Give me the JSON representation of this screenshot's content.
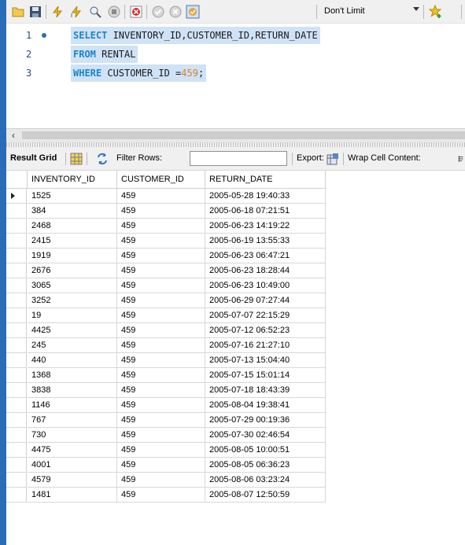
{
  "toolbar": {
    "limit_label": "Don't Limit"
  },
  "editor": {
    "lines": [
      {
        "number": "1",
        "keyword1": "SELECT",
        "rest": " INVENTORY_ID,CUSTOMER_ID,RETURN_DATE"
      },
      {
        "number": "2",
        "keyword1": "FROM",
        "rest": " RENTAL"
      },
      {
        "number": "3",
        "keyword1": "WHERE",
        "rest": " CUSTOMER_ID =",
        "number_literal": "459",
        "tail": ";"
      }
    ]
  },
  "result_toolbar": {
    "result_grid_label": "Result Grid",
    "filter_rows_label": "Filter Rows:",
    "filter_value": "",
    "export_label": "Export:",
    "wrap_label": "Wrap Cell Content:"
  },
  "grid": {
    "columns": [
      "INVENTORY_ID",
      "CUSTOMER_ID",
      "RETURN_DATE"
    ],
    "rows": [
      [
        "1525",
        "459",
        "2005-05-28 19:40:33"
      ],
      [
        "384",
        "459",
        "2005-06-18 07:21:51"
      ],
      [
        "2468",
        "459",
        "2005-06-23 14:19:22"
      ],
      [
        "2415",
        "459",
        "2005-06-19 13:55:33"
      ],
      [
        "1919",
        "459",
        "2005-06-23 06:47:21"
      ],
      [
        "2676",
        "459",
        "2005-06-23 18:28:44"
      ],
      [
        "3065",
        "459",
        "2005-06-23 10:49:00"
      ],
      [
        "3252",
        "459",
        "2005-06-29 07:27:44"
      ],
      [
        "19",
        "459",
        "2005-07-07 22:15:29"
      ],
      [
        "4425",
        "459",
        "2005-07-12 06:52:23"
      ],
      [
        "245",
        "459",
        "2005-07-16 21:27:10"
      ],
      [
        "440",
        "459",
        "2005-07-13 15:04:40"
      ],
      [
        "1368",
        "459",
        "2005-07-15 15:01:14"
      ],
      [
        "3838",
        "459",
        "2005-07-18 18:43:39"
      ],
      [
        "1146",
        "459",
        "2005-08-04 19:38:41"
      ],
      [
        "767",
        "459",
        "2005-07-29 00:19:36"
      ],
      [
        "730",
        "459",
        "2005-07-30 02:46:54"
      ],
      [
        "4475",
        "459",
        "2005-08-05 10:00:51"
      ],
      [
        "4001",
        "459",
        "2005-08-05 06:36:23"
      ],
      [
        "4579",
        "459",
        "2005-08-06 03:23:24"
      ],
      [
        "1481",
        "459",
        "2005-08-07 12:50:59"
      ]
    ]
  },
  "icons": [
    "folder-icon",
    "save-icon",
    "execute-icon",
    "execute-current-icon",
    "explain-icon",
    "stop-icon",
    "toggle-error-icon",
    "commit-icon",
    "rollback-icon",
    "autocommit-icon",
    "bookmark-icon"
  ],
  "colors": {
    "selection": "#cfe2f6",
    "keyword": "#1c86c8",
    "number": "#d9822b",
    "accent": "#2b6cb8"
  }
}
